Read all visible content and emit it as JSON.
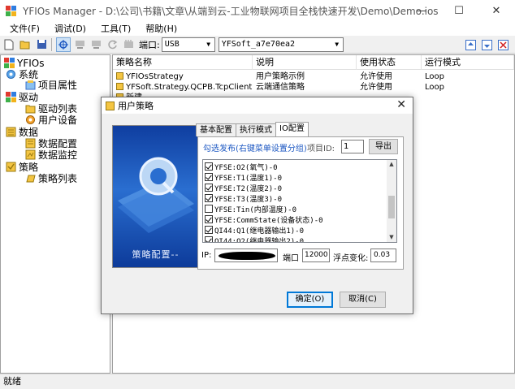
{
  "window": {
    "title": "YFIOs Manager - D:\\公司\\书籍\\文章\\从端到云-工业物联网项目全栈快速开发\\Demo\\Demo.ios",
    "min": "—",
    "max": "☐",
    "close": "✕"
  },
  "menu": [
    "文件(F)",
    "调试(D)",
    "工具(T)",
    "帮助(H)"
  ],
  "toolbar": {
    "port_label": "端口:",
    "port_value": "USB",
    "device_value": "YFSoft_a7e70ea2"
  },
  "tree": {
    "root": "YFIOs",
    "system": "系统",
    "project_props": "项目属性",
    "driver": "驱动",
    "driver_list": "驱动列表",
    "user_devices": "用户设备",
    "data": "数据",
    "data_config": "数据配置",
    "data_monitor": "数据监控",
    "strategy": "策略",
    "strategy_list": "策略列表"
  },
  "list": {
    "columns": [
      "策略名称",
      "说明",
      "使用状态",
      "运行模式"
    ],
    "rows": [
      [
        "YFIOsStrategy",
        "用户策略示例",
        "允许使用",
        "Loop"
      ],
      [
        "YFSoft.Strategy.QCPB.TcpClient",
        "云端通信策略",
        "允许使用",
        "Loop"
      ],
      [
        "新建",
        "",
        "",
        ""
      ]
    ]
  },
  "status": "就绪",
  "dialog": {
    "title": "用户策略",
    "close": "✕",
    "side_caption": "策略配置--",
    "tabs": [
      "基本配置",
      "执行模式",
      "IO配置"
    ],
    "publish_label": "勾选发布(右键菜单设置分组)",
    "item_id_label": "项目ID:",
    "item_id_value": "1",
    "import_button": "导出",
    "items": [
      {
        "label": "YFSE:O2(氧气)-0",
        "checked": true
      },
      {
        "label": "YFSE:T1(温度1)-0",
        "checked": true
      },
      {
        "label": "YFSE:T2(温度2)-0",
        "checked": true
      },
      {
        "label": "YFSE:T3(温度3)-0",
        "checked": true
      },
      {
        "label": "YFSE:Tin(内部温度)-0",
        "checked": false
      },
      {
        "label": "YFSE:CommState(设备状态)-0",
        "checked": true
      },
      {
        "label": "QI44:Q1(继电器输出1)-0",
        "checked": true
      },
      {
        "label": "QI44:Q2(继电器输出2)-0",
        "checked": true
      }
    ],
    "ip_label": "IP:",
    "port_label": "端口",
    "port_value": "12000",
    "float_label": "浮点变化:",
    "float_value": "0.03",
    "ok_button": "确定(O)",
    "cancel_button": "取消(C)"
  }
}
